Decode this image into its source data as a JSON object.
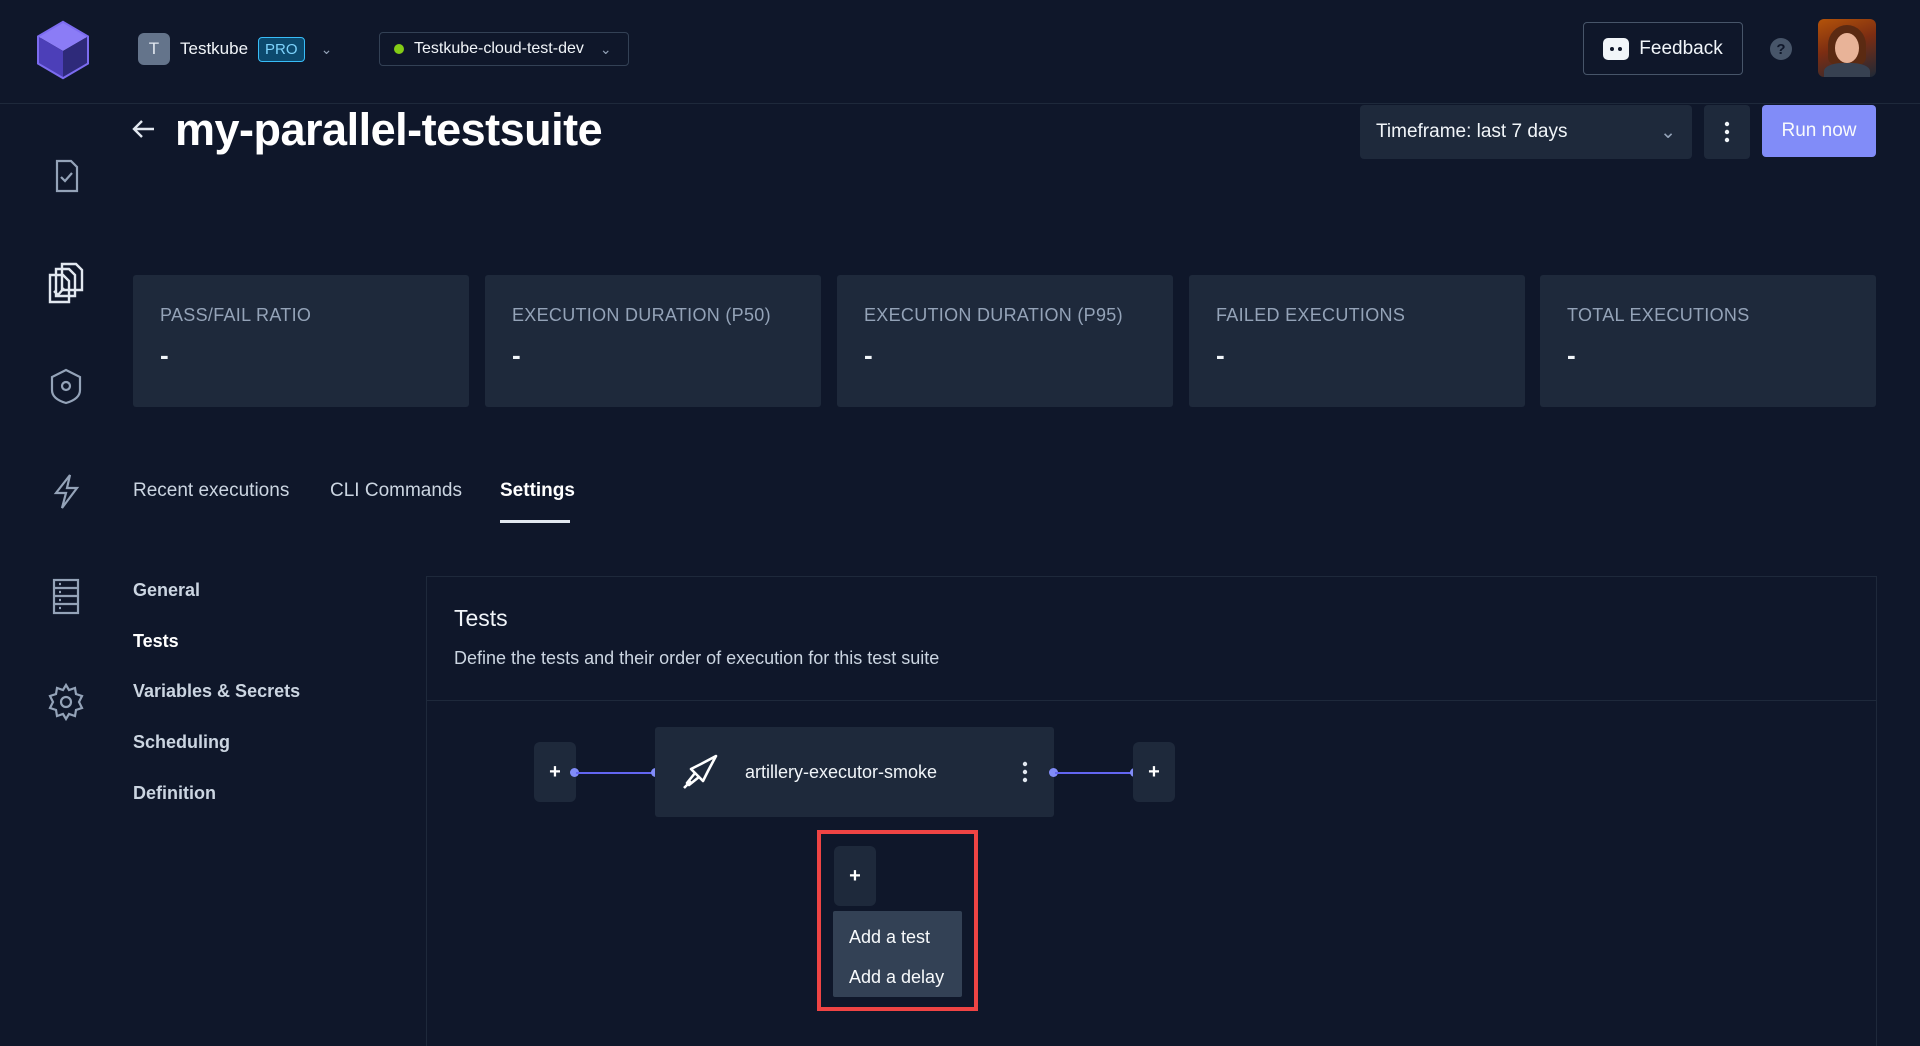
{
  "header": {
    "org": {
      "initial": "T",
      "name": "Testkube",
      "badge": "PRO"
    },
    "environment": "Testkube-cloud-test-dev",
    "feedback_label": "Feedback",
    "help_label": "?"
  },
  "colors": {
    "background": "#0f172a",
    "card": "#1e293b",
    "accent": "#818cf8",
    "connector": "#6366f1",
    "env_status": "#84cc16",
    "highlight": "#ef4444"
  },
  "sidebar": {
    "items": [
      {
        "icon": "test-file-icon"
      },
      {
        "icon": "test-suites-icon"
      },
      {
        "icon": "executors-shield-icon"
      },
      {
        "icon": "triggers-lightning-icon"
      },
      {
        "icon": "sources-list-icon"
      },
      {
        "icon": "settings-gear-icon"
      }
    ]
  },
  "page": {
    "title": "my-parallel-testsuite",
    "timeframe": "Timeframe: last 7 days",
    "run_label": "Run now"
  },
  "metrics": [
    {
      "label": "PASS/FAIL RATIO",
      "value": "-"
    },
    {
      "label": "EXECUTION DURATION (P50)",
      "value": "-"
    },
    {
      "label": "EXECUTION DURATION (P95)",
      "value": "-"
    },
    {
      "label": "FAILED EXECUTIONS",
      "value": "-"
    },
    {
      "label": "TOTAL EXECUTIONS",
      "value": "-"
    }
  ],
  "tabs": [
    {
      "label": "Recent executions"
    },
    {
      "label": "CLI Commands"
    },
    {
      "label": "Settings",
      "active": true
    }
  ],
  "settings_nav": [
    {
      "label": "General"
    },
    {
      "label": "Tests",
      "active": true
    },
    {
      "label": "Variables & Secrets"
    },
    {
      "label": "Scheduling"
    },
    {
      "label": "Definition"
    }
  ],
  "tests_panel": {
    "title": "Tests",
    "description": "Define the tests and their order of execution for this test suite",
    "plus": "+",
    "node": {
      "label": "artillery-executor-smoke",
      "icon": "artillery-icon"
    },
    "menu": [
      "Add a test",
      "Add a delay"
    ]
  }
}
